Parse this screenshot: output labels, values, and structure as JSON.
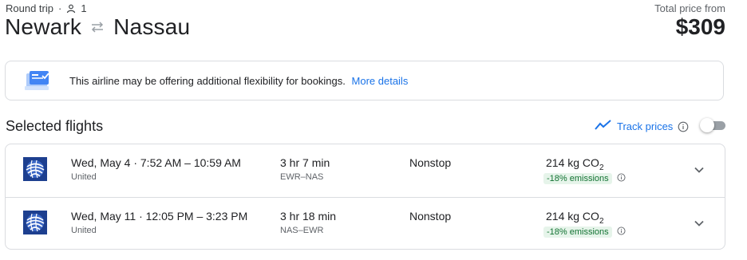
{
  "header": {
    "trip_type": "Round trip",
    "separator": "·",
    "passengers": "1",
    "origin": "Newark",
    "destination": "Nassau",
    "price_label": "Total price from",
    "price": "$309"
  },
  "banner": {
    "text": "This airline may be offering additional flexibility for bookings.",
    "link": "More details"
  },
  "selected": {
    "title": "Selected flights",
    "track_label": "Track prices",
    "track_enabled": false
  },
  "flights": [
    {
      "date": "Wed, May 4",
      "sep": "·",
      "times": "7:52 AM – 10:59 AM",
      "airline": "United",
      "duration": "3 hr 7 min",
      "airports": "EWR–NAS",
      "stops": "Nonstop",
      "co2_value": "214 kg CO",
      "co2_sub": "2",
      "emissions": "-18% emissions"
    },
    {
      "date": "Wed, May 11",
      "sep": "·",
      "times": "12:05 PM – 3:23 PM",
      "airline": "United",
      "duration": "3 hr 18 min",
      "airports": "NAS–EWR",
      "stops": "Nonstop",
      "co2_value": "214 kg CO",
      "co2_sub": "2",
      "emissions": "-18% emissions"
    }
  ],
  "icons": {
    "person": "person-icon",
    "swap": "swap-arrows-icon",
    "banner": "flexibility-illustration-icon",
    "trend": "trend-line-icon",
    "info": "info-icon",
    "airline_logo": "united-globe-logo",
    "expand": "chevron-down-icon"
  },
  "colors": {
    "link": "#1a73e8",
    "emissions_bg": "#e6f4ea",
    "emissions_text": "#137333",
    "united_blue": "#1d3f8f"
  }
}
